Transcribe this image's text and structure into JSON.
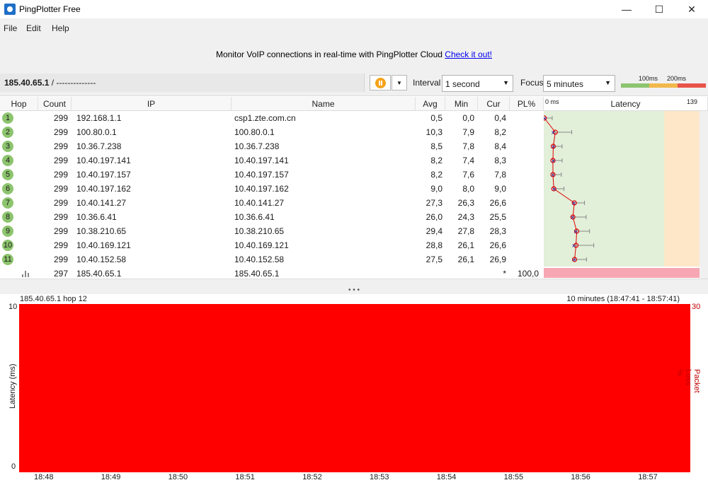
{
  "window": {
    "title": "PingPlotter Free",
    "minimize": "—",
    "maximize": "☐",
    "close": "✕"
  },
  "menu": [
    "File",
    "Edit",
    "Help"
  ],
  "banner": {
    "text": "Monitor VoIP connections in real-time with PingPlotter Cloud",
    "link": "Check it out!"
  },
  "toolbar": {
    "target_bold": "185.40.65.1",
    "target_rest": " /  --------------",
    "interval_label": "Interval",
    "interval_value": "1 second",
    "focus_label": "Focus",
    "focus_value": "5 minutes",
    "legend_100": "100ms",
    "legend_200": "200ms",
    "legend_colors": [
      "#8dc46e",
      "#f2b84b",
      "#e8534a"
    ]
  },
  "grid": {
    "headers": {
      "hop": "Hop",
      "count": "Count",
      "ip": "IP",
      "name": "Name",
      "avg": "Avg",
      "min": "Min",
      "cur": "Cur",
      "pl": "PL%",
      "latency": "Latency"
    },
    "latency_scale_min": "0 ms",
    "latency_scale_max": "139",
    "rows": [
      {
        "hop": "1",
        "count": "299",
        "ip": "192.168.1.1",
        "name": "csp1.zte.com.cn",
        "avg": "0,5",
        "min": "0,0",
        "cur": "0,4",
        "pl": ""
      },
      {
        "hop": "2",
        "count": "299",
        "ip": "100.80.0.1",
        "name": "100.80.0.1",
        "avg": "10,3",
        "min": "7,9",
        "cur": "8,2",
        "pl": ""
      },
      {
        "hop": "3",
        "count": "299",
        "ip": "10.36.7.238",
        "name": "10.36.7.238",
        "avg": "8,5",
        "min": "7,8",
        "cur": "8,4",
        "pl": ""
      },
      {
        "hop": "4",
        "count": "299",
        "ip": "10.40.197.141",
        "name": "10.40.197.141",
        "avg": "8,2",
        "min": "7,4",
        "cur": "8,3",
        "pl": ""
      },
      {
        "hop": "5",
        "count": "299",
        "ip": "10.40.197.157",
        "name": "10.40.197.157",
        "avg": "8,2",
        "min": "7,6",
        "cur": "7,8",
        "pl": ""
      },
      {
        "hop": "6",
        "count": "299",
        "ip": "10.40.197.162",
        "name": "10.40.197.162",
        "avg": "9,0",
        "min": "8,0",
        "cur": "9,0",
        "pl": ""
      },
      {
        "hop": "7",
        "count": "299",
        "ip": "10.40.141.27",
        "name": "10.40.141.27",
        "avg": "27,3",
        "min": "26,3",
        "cur": "26,6",
        "pl": ""
      },
      {
        "hop": "8",
        "count": "299",
        "ip": "10.36.6.41",
        "name": "10.36.6.41",
        "avg": "26,0",
        "min": "24,3",
        "cur": "25,5",
        "pl": ""
      },
      {
        "hop": "9",
        "count": "299",
        "ip": "10.38.210.65",
        "name": "10.38.210.65",
        "avg": "29,4",
        "min": "27,8",
        "cur": "28,3",
        "pl": ""
      },
      {
        "hop": "10",
        "count": "299",
        "ip": "10.40.169.121",
        "name": "10.40.169.121",
        "avg": "28,8",
        "min": "26,1",
        "cur": "26,6",
        "pl": ""
      },
      {
        "hop": "11",
        "count": "299",
        "ip": "10.40.152.58",
        "name": "10.40.152.58",
        "avg": "27,5",
        "min": "26,1",
        "cur": "26,9",
        "pl": ""
      },
      {
        "hop": "",
        "count": "297",
        "ip": "185.40.65.1",
        "name": "185.40.65.1",
        "avg": "",
        "min": "",
        "cur": "*",
        "pl": "100,0"
      }
    ]
  },
  "graph": {
    "title": "185.40.65.1 hop 12",
    "range": "10 minutes (18:47:41 - 18:57:41)",
    "y_left_label": "Latency (ms)",
    "y_right_label": "Packet Loss %",
    "y_left_max": "10",
    "y_left_min": "0",
    "y_right_max": "30",
    "x_ticks": [
      "18:48",
      "18:49",
      "18:50",
      "18:51",
      "18:52",
      "18:53",
      "18:54",
      "18:55",
      "18:56",
      "18:57"
    ],
    "fill_color": "#ff0000"
  }
}
